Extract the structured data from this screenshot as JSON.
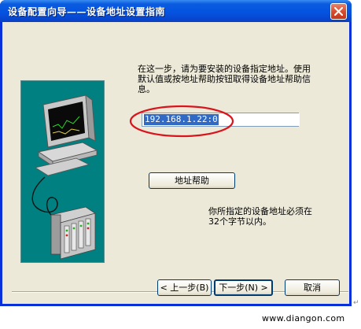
{
  "window": {
    "title": "设备配置向导——设备地址设置指南",
    "close_icon": "close-icon"
  },
  "content": {
    "description": "在这一步，请为要安装的设备指定地址。使用默认值或按地址帮助按钮取得设备地址帮助信息。",
    "address_value": "192.168.1.22:0",
    "help_button": "地址帮助",
    "note": "你所指定的设备地址必须在32个字节以内。"
  },
  "footer": {
    "prev_button": "< 上一步(B)",
    "next_button": "下一步(N) >",
    "cancel_button": "取消"
  },
  "watermark": "www.diangon.com",
  "colors": {
    "titlebar": "#0452df",
    "dialog_bg": "#ece9d8",
    "wizard_image_bg": "#008080",
    "highlight_ellipse": "#d9141c",
    "selection": "#316ac5"
  }
}
